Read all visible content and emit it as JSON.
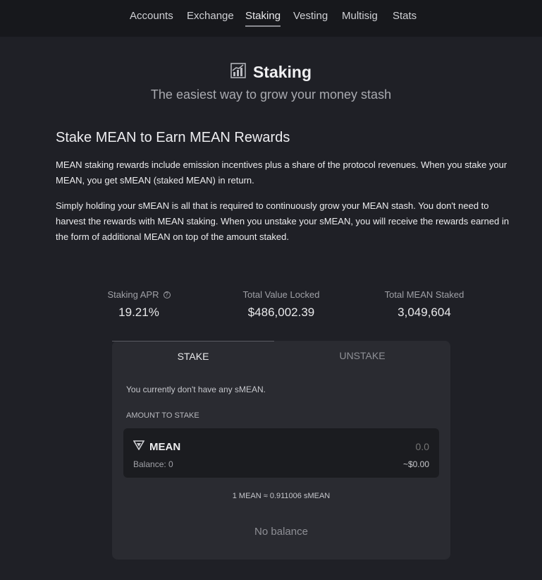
{
  "nav": {
    "tabs": [
      "Accounts",
      "Exchange",
      "Staking",
      "Vesting",
      "Multisig",
      "Stats"
    ],
    "active": "Staking"
  },
  "hero": {
    "title": "Staking",
    "subtitle": "The easiest way to grow your money stash",
    "icon": "chart-growth-icon"
  },
  "intro": {
    "heading": "Stake MEAN to Earn MEAN Rewards",
    "paragraph1": "MEAN staking rewards include emission incentives plus a share of the protocol revenues. When you stake your MEAN, you get sMEAN (staked MEAN) in return.",
    "paragraph2": "Simply holding your sMEAN is all that is required to continuously grow your MEAN stash. You don't need to harvest the rewards with MEAN staking. When you unstake your sMEAN, you will receive the rewards earned in the form of additional MEAN on top of the amount staked."
  },
  "stats": {
    "apr_label": "Staking APR",
    "apr_value": "19.21%",
    "tvl_label": "Total Value Locked",
    "tvl_value": "$486,002.39",
    "staked_label": "Total MEAN Staked",
    "staked_value": "3,049,604"
  },
  "card": {
    "stake_tab": "STAKE",
    "unstake_tab": "UNSTAKE",
    "message": "You currently don't have any sMEAN.",
    "amount_label": "AMOUNT TO STAKE",
    "token": "MEAN",
    "amount_placeholder": "0.0",
    "balance_text": "Balance: 0",
    "usd_value": "~$0.00",
    "rate": "1 MEAN ≈ 0.911006 sMEAN",
    "button": "No balance"
  }
}
